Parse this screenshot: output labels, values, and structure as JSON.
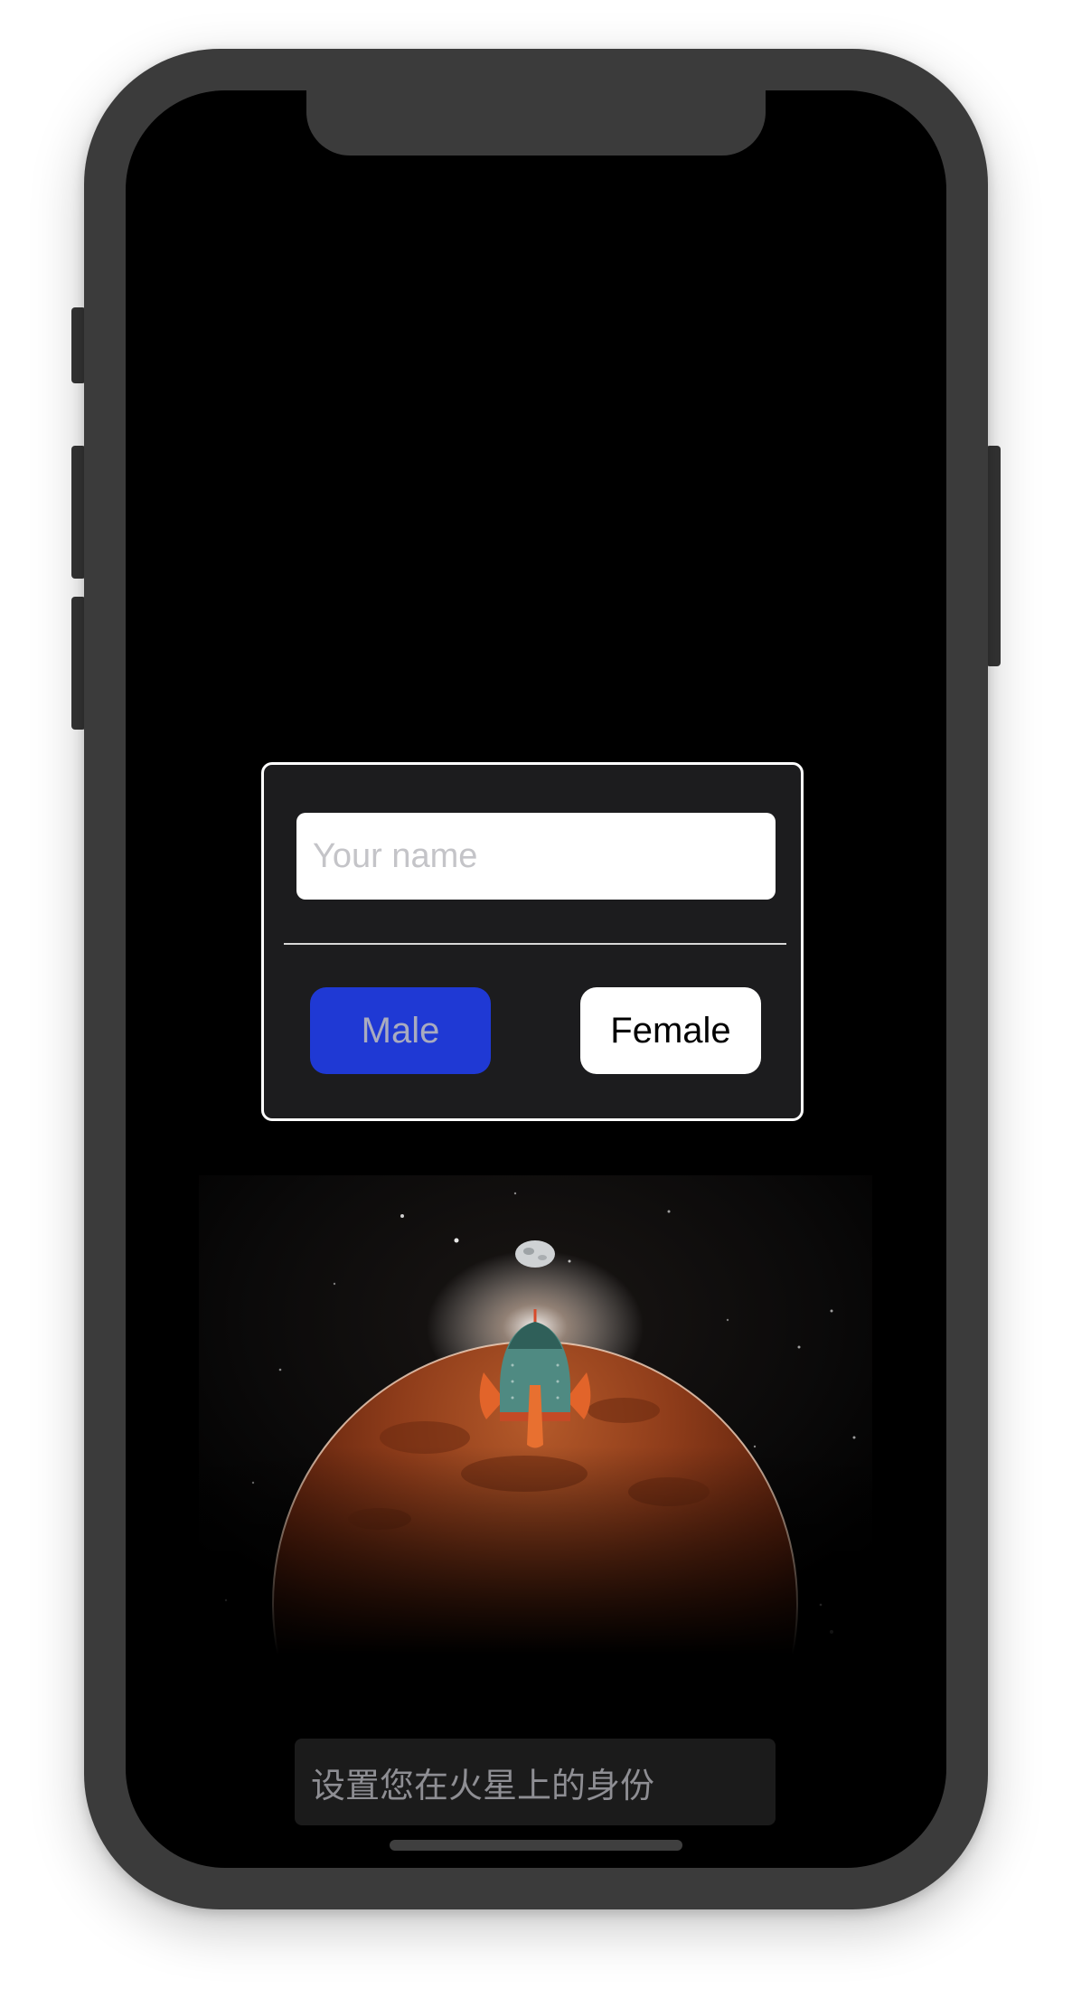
{
  "dialog": {
    "name_input": {
      "placeholder": "Your name",
      "value": ""
    },
    "male_label": "Male",
    "female_label": "Female"
  },
  "caption": {
    "text": "设置您在火星上的身份"
  },
  "colors": {
    "male_button": "#1f39d4",
    "female_button": "#ffffff",
    "card_background": "#1c1c1e",
    "screen_background": "#000000"
  },
  "illustration": {
    "icons": [
      "moon-icon",
      "rocket-icon",
      "mars-planet-icon"
    ]
  }
}
